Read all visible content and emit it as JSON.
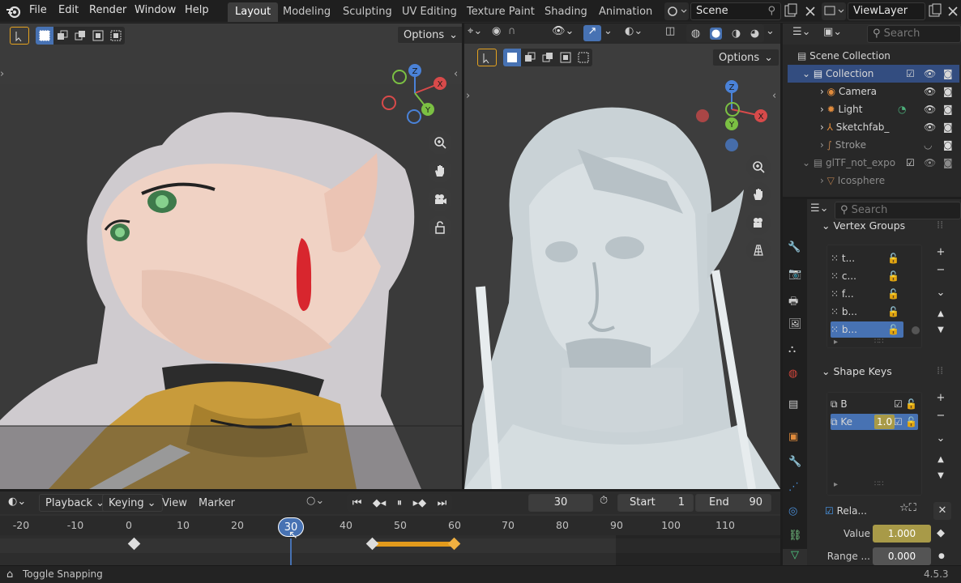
{
  "menu": {
    "file": "File",
    "edit": "Edit",
    "render": "Render",
    "window": "Window",
    "help": "Help"
  },
  "workspaces": [
    "Layout",
    "Modeling",
    "Sculpting",
    "UV Editing",
    "Texture Paint",
    "Shading",
    "Animation"
  ],
  "scene": {
    "label": "Scene",
    "viewlayer": "ViewLayer"
  },
  "viewport_left": {
    "options": "Options"
  },
  "viewport_right": {
    "options": "Options"
  },
  "gizmo": {
    "x": "X",
    "y": "Y",
    "z": "Z"
  },
  "outliner": {
    "search_placeholder": "Search",
    "root": "Scene Collection",
    "items": [
      {
        "label": "Collection"
      },
      {
        "label": "Camera"
      },
      {
        "label": "Light"
      },
      {
        "label": "Sketchfab_"
      },
      {
        "label": "Stroke"
      },
      {
        "label": "glTF_not_expo"
      },
      {
        "label": "Icosphere"
      }
    ]
  },
  "properties": {
    "search_placeholder": "Search",
    "vertex_groups_title": "Vertex Groups",
    "vertex_groups": [
      "t...",
      "c...",
      "f...",
      "b...",
      "b..."
    ],
    "shape_keys_title": "Shape Keys",
    "shape_keys": [
      {
        "label": "B"
      },
      {
        "label": "Ke",
        "value": "1.0"
      }
    ],
    "relative_label": "Rela...",
    "value_label": "Value",
    "value": "1.000",
    "range_label": "Range ...",
    "range_value": "0.000"
  },
  "timeline": {
    "playback": "Playback",
    "keying": "Keying",
    "view": "View",
    "marker": "Marker",
    "current_frame": "30",
    "start_label": "Start",
    "start": "1",
    "end_label": "End",
    "end": "90",
    "ruler": [
      "-20",
      "-10",
      "0",
      "10",
      "20",
      "30",
      "40",
      "50",
      "60",
      "70",
      "80",
      "90",
      "100",
      "110"
    ]
  },
  "status": {
    "hint": "Toggle Snapping",
    "version": "4.5.3"
  },
  "colors": {
    "accent": "#4772b3",
    "keyframe_orange": "#e29a1c",
    "value_yellow": "#a89a48"
  }
}
